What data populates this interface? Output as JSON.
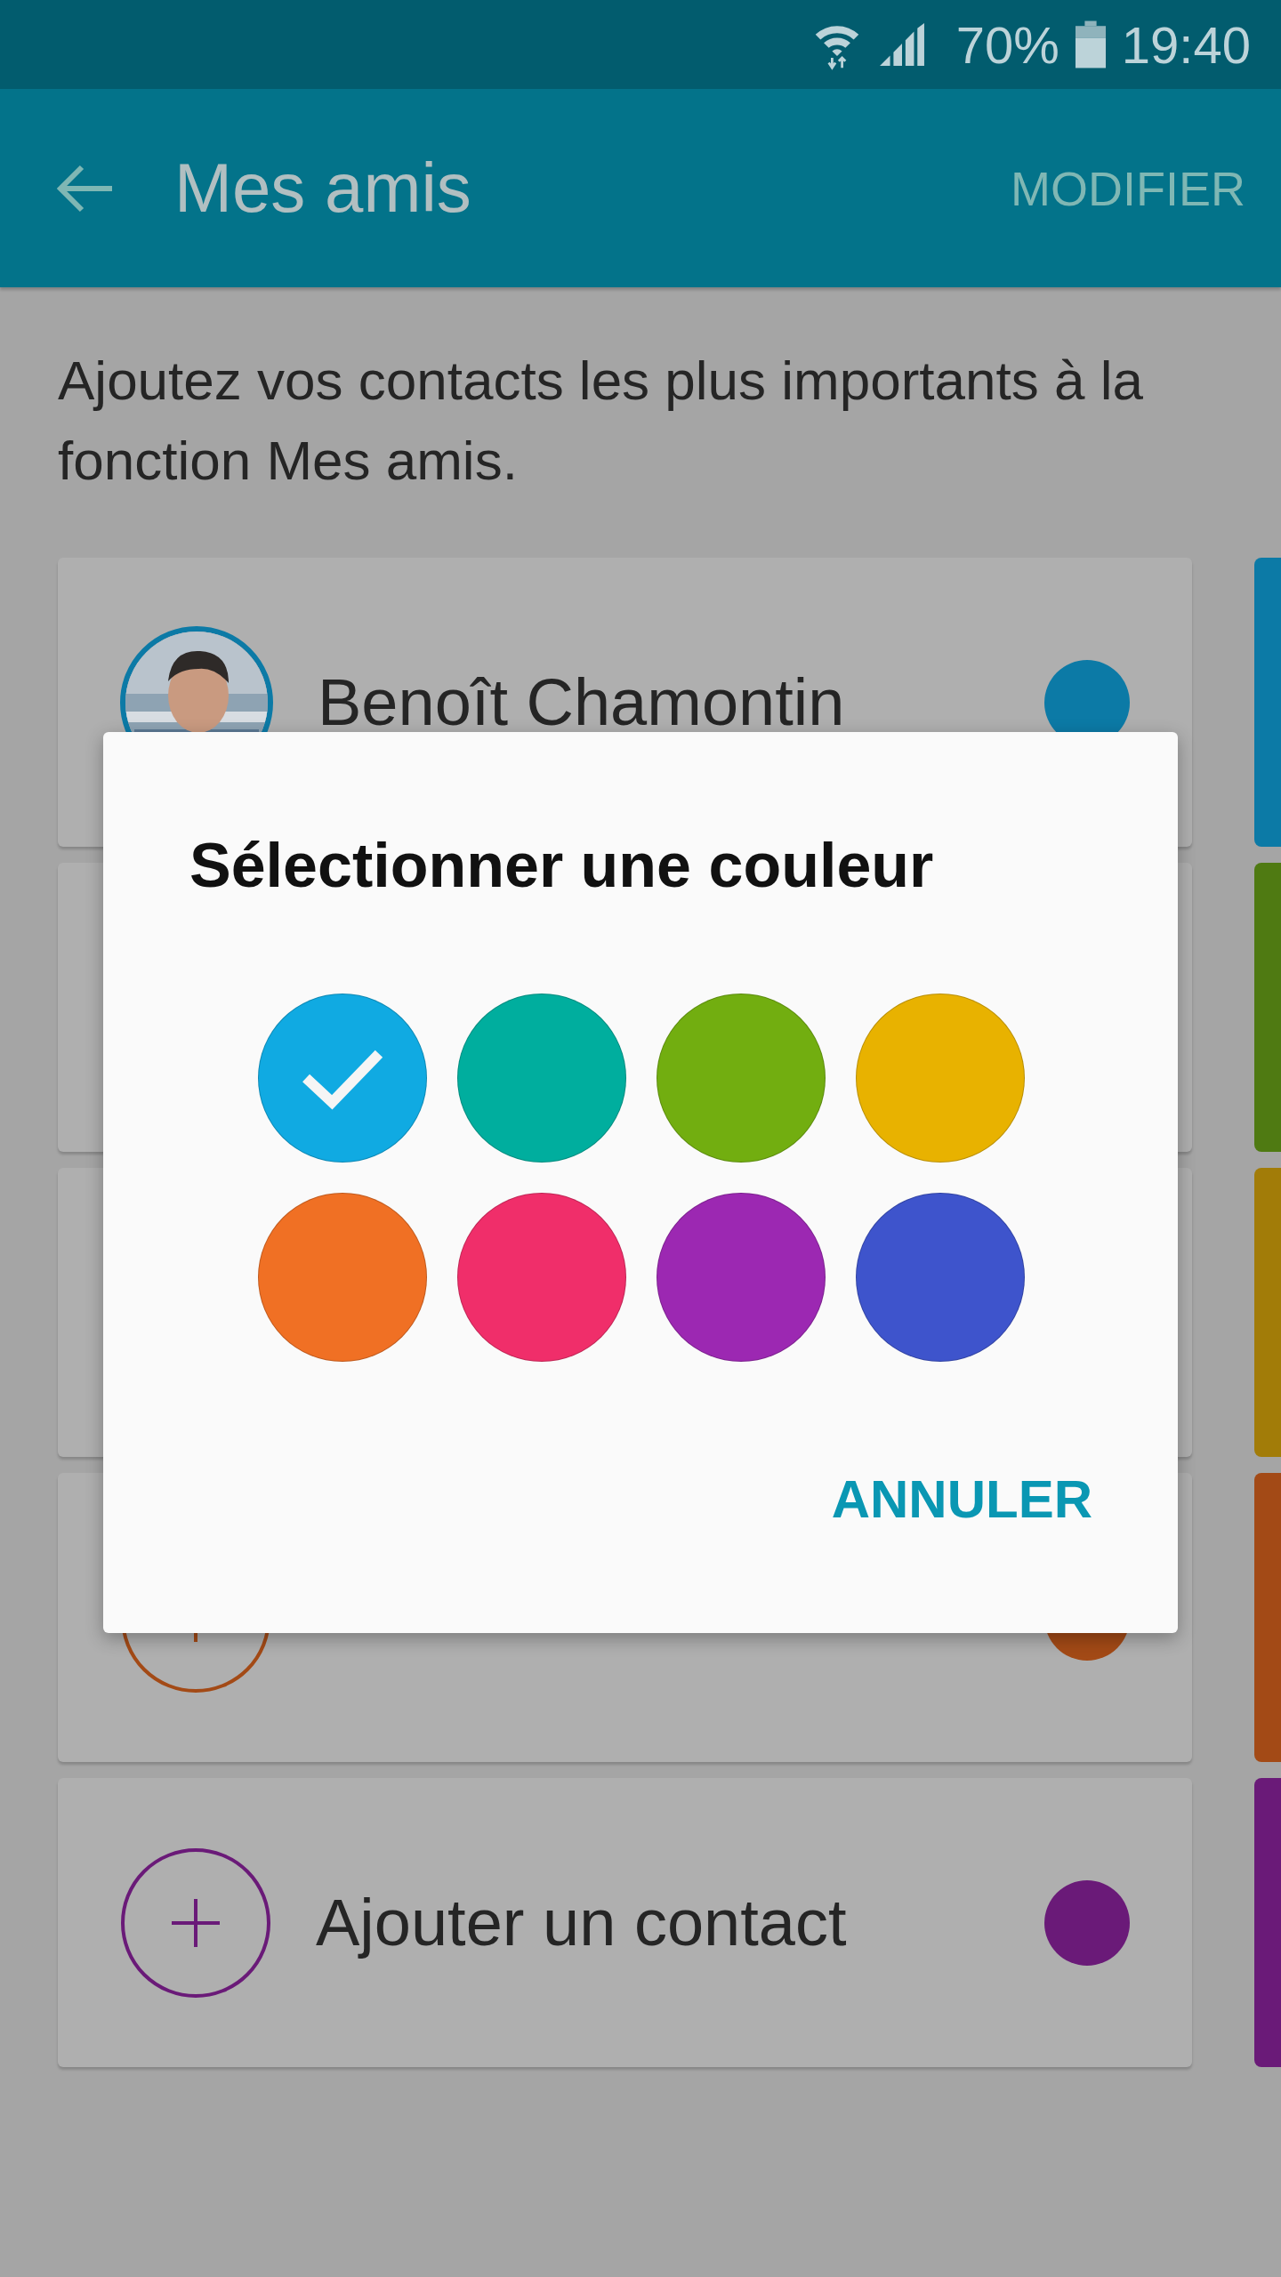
{
  "status_bar": {
    "battery": "70%",
    "time": "19:40"
  },
  "app_bar": {
    "title": "Mes amis",
    "action": "MODIFIER"
  },
  "description": "Ajoutez vos contacts les plus importants à la fonction Mes amis.",
  "contacts": [
    {
      "kind": "contact",
      "name": "Benoît Chamontin",
      "color": "#0c7aa6"
    },
    {
      "kind": "hidden",
      "color": "#4f7a12"
    },
    {
      "kind": "hidden",
      "color": "#a27c08"
    },
    {
      "kind": "add",
      "color": "#a34a16"
    },
    {
      "kind": "add",
      "label": "Ajouter un contact",
      "color": "#6a1a78"
    }
  ],
  "dialog": {
    "title": "Sélectionner une couleur",
    "swatches": [
      {
        "color": "#10aae2",
        "selected": true
      },
      {
        "color": "#00ae9e",
        "selected": false
      },
      {
        "color": "#72ae10",
        "selected": false
      },
      {
        "color": "#e8b200",
        "selected": false
      },
      {
        "color": "#f07024",
        "selected": false
      },
      {
        "color": "#f02e6a",
        "selected": false
      },
      {
        "color": "#9c28b2",
        "selected": false
      },
      {
        "color": "#3e54cc",
        "selected": false
      }
    ],
    "button": "ANNULER"
  }
}
